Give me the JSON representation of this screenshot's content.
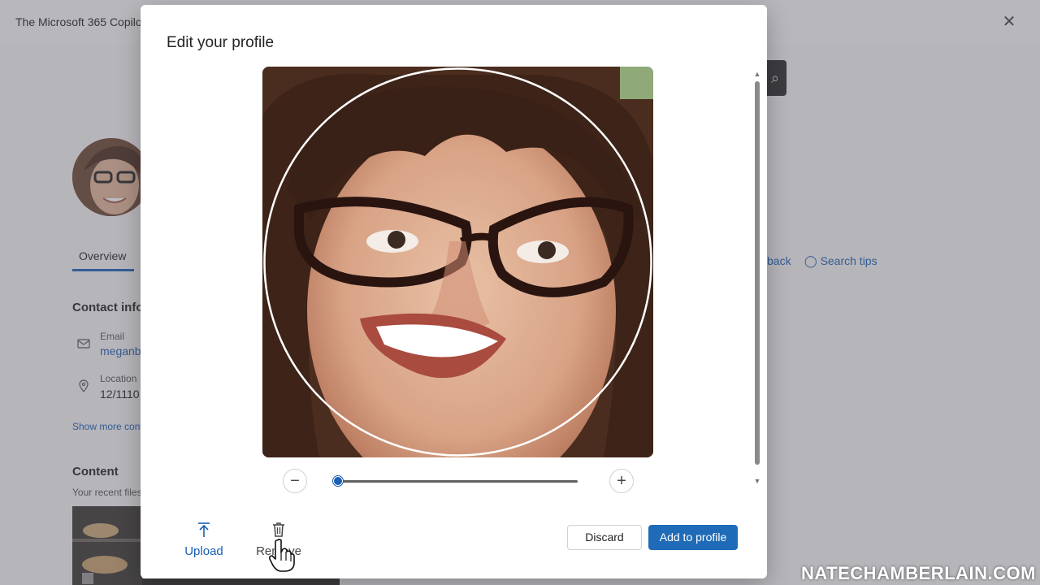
{
  "background": {
    "app_title": "The Microsoft 365 Copilo",
    "close_glyph": "✕",
    "search_glyph": "⌕",
    "tabs": [
      {
        "label": "Overview",
        "selected": true
      }
    ],
    "header_links": [
      {
        "label": "back",
        "icon": "feedback-icon"
      },
      {
        "label": "Search tips",
        "icon": "lightbulb-icon"
      }
    ],
    "contact_heading": "Contact info",
    "contact_fields": [
      {
        "label": "Email",
        "value": "meganb",
        "icon": "mail-icon"
      },
      {
        "label": "Location",
        "value": "12/1110",
        "icon": "location-pin-icon"
      }
    ],
    "show_more_label": "Show more cont",
    "content_heading": "Content",
    "content_subheading": "Your recent files"
  },
  "dialog": {
    "title": "Edit your profile",
    "photo_alt": "profile-photo",
    "zoom": {
      "minus_glyph": "−",
      "plus_glyph": "+",
      "level": 0.0
    },
    "actions": {
      "upload_label": "Upload",
      "remove_label": "Remove"
    },
    "buttons": {
      "discard_label": "Discard",
      "add_label": "Add to profile"
    }
  },
  "colors": {
    "accent": "#1f6bb8",
    "link": "#1a5fb4"
  },
  "watermark": "NATECHAMBERLAIN.COM"
}
